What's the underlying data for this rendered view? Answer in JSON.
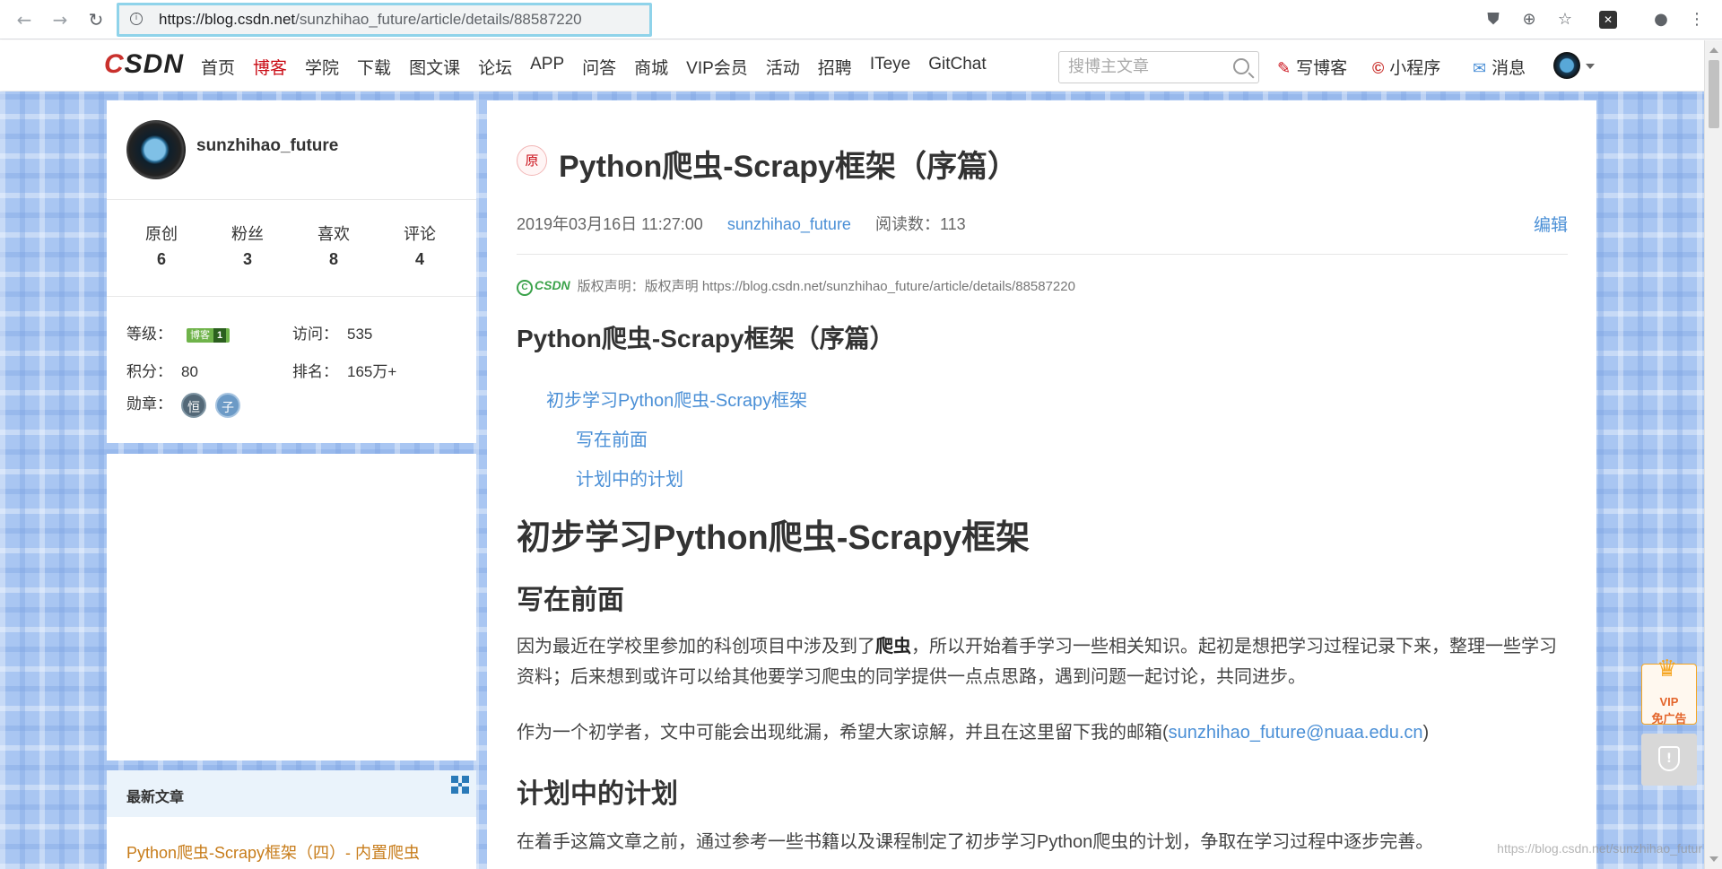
{
  "browser": {
    "url_host": "https://blog.csdn.net",
    "url_path": "/sunzhihao_future/article/details/88587220"
  },
  "topnav": {
    "logo_left": "C",
    "logo_rest": "SDN",
    "items": [
      {
        "label": "首页"
      },
      {
        "label": "博客"
      },
      {
        "label": "学院"
      },
      {
        "label": "下载"
      },
      {
        "label": "图文课"
      },
      {
        "label": "论坛"
      },
      {
        "label": "APP"
      },
      {
        "label": "问答"
      },
      {
        "label": "商城"
      },
      {
        "label": "VIP会员"
      },
      {
        "label": "活动"
      },
      {
        "label": "招聘"
      },
      {
        "label": "ITeye"
      },
      {
        "label": "GitChat"
      }
    ],
    "search_placeholder": "搜博主文章",
    "write_blog": "写博客",
    "mini_program": "小程序",
    "messages": "消息"
  },
  "profile": {
    "name": "sunzhihao_future",
    "stats": [
      {
        "label": "原创",
        "value": "6"
      },
      {
        "label": "粉丝",
        "value": "3"
      },
      {
        "label": "喜欢",
        "value": "8"
      },
      {
        "label": "评论",
        "value": "4"
      }
    ],
    "level_label": "等级：",
    "level_badge": "博客",
    "level_num": "1",
    "visits_label": "访问：",
    "visits_value": "535",
    "points_label": "积分：",
    "points_value": "80",
    "rank_label": "排名：",
    "rank_value": "165万+",
    "medals_label": "勋章：",
    "medal1": "恒",
    "medal2": "子"
  },
  "recent": {
    "title": "最新文章",
    "first_item": "Python爬虫-Scrapy框架（四）- 内置爬虫"
  },
  "article": {
    "original_badge": "原",
    "title": "Python爬虫-Scrapy框架（序篇）",
    "date": "2019年03月16日 11:27:00",
    "author": "sunzhihao_future",
    "reads": "阅读数：113",
    "edit": "编辑",
    "cert_logo": "CSDN",
    "copyright": "版权声明：版权声明 https://blog.csdn.net/sunzhihao_future/article/details/88587220",
    "toc_heading": "Python爬虫-Scrapy框架（序篇）",
    "toc": [
      "初步学习Python爬虫-Scrapy框架",
      "写在前面",
      "计划中的计划"
    ],
    "h1": "初步学习Python爬虫-Scrapy框架",
    "h2_intro": "写在前面",
    "p1_a": "因为最近在学校里参加的科创项目中涉及到了",
    "p1_bold": "爬虫",
    "p1_b": "，所以开始着手学习一些相关知识。起初是想把学习过程记录下来，整理一些学习资料；后来想到或许可以给其他要学习爬虫的同学提供一点点思路，遇到问题一起讨论，共同进步。",
    "p2_a": "作为一个初学者，文中可能会出现纰漏，希望大家谅解，并且在这里留下我的邮箱(",
    "p2_email": "sunzhihao_future@nuaa.edu.cn",
    "p2_b": ")",
    "h2_plan": "计划中的计划",
    "p3": "在着手这篇文章之前，通过参考一些书籍以及课程制定了初步学习Python爬虫的计划，争取在学习过程中逐步完善。"
  },
  "watermark": "https://blog.csdn.net/sunzhihao_futur",
  "vip": {
    "line1": "VIP",
    "line2": "免广告"
  }
}
